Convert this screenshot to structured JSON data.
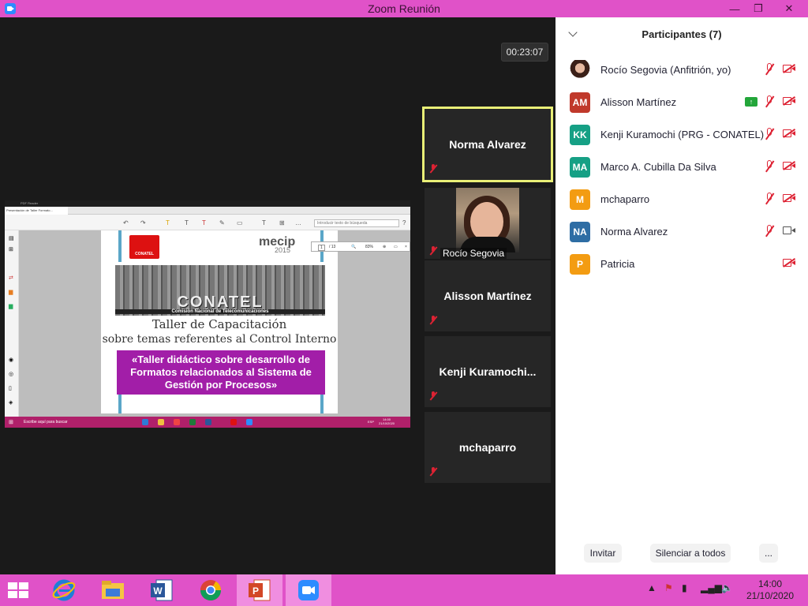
{
  "window": {
    "title": "Zoom Reunión",
    "min": "—",
    "max": "❐",
    "close": "✕"
  },
  "timer": "00:23:07",
  "shared_screen": {
    "app_title": "PDF Reader",
    "tab": "Presentación de Taller Formato...",
    "search_placeholder": "Introducir texto de búsqueda",
    "page": "1",
    "pages": "/ 13",
    "zoom": "83%",
    "slide": {
      "logo": "CONATEL",
      "mecip": "mecip",
      "mecip_year": "2015",
      "building_text": "CONATEL",
      "building_sub": "Comisión Nacional de Telecomunicaciones",
      "line1": "Taller de Capacitación",
      "line2": "sobre temas referentes al Control Interno",
      "box": "«Taller didáctico sobre desarrollo de Formatos relacionados al Sistema de Gestión por Procesos»"
    },
    "taskbar": {
      "search": "Escribe aquí para buscar",
      "time": "14:00",
      "date": "21/10/2020",
      "lang": "ESP"
    }
  },
  "tiles": [
    {
      "name": "Norma Alvarez"
    },
    {
      "name": "Rocío Segovia"
    },
    {
      "name": "Alisson Martínez"
    },
    {
      "name": "Kenji  Kuramochi..."
    },
    {
      "name": "mchaparro"
    }
  ],
  "participants": {
    "header": "Participantes (7)",
    "list": [
      {
        "initials": "",
        "name": "Rocío Segovia (Anfitrión, yo)",
        "color": "#ffffff",
        "photo": true,
        "mic": "muted",
        "cam": "off",
        "sharing": false
      },
      {
        "initials": "AM",
        "name": "Alisson Martínez",
        "color": "#c0392b",
        "mic": "muted",
        "cam": "off",
        "sharing": true
      },
      {
        "initials": "KK",
        "name": "Kenji Kuramochi (PRG - CONATEL)",
        "color": "#16a085",
        "mic": "muted",
        "cam": "off",
        "sharing": false
      },
      {
        "initials": "MA",
        "name": "Marco A. Cubilla Da Silva",
        "color": "#16a085",
        "mic": "muted",
        "cam": "off",
        "sharing": false
      },
      {
        "initials": "M",
        "name": "mchaparro",
        "color": "#f39c12",
        "mic": "muted",
        "cam": "off",
        "sharing": false
      },
      {
        "initials": "NA",
        "name": "Norma Alvarez",
        "color": "#2e6da4",
        "mic": "muted",
        "cam": "on",
        "sharing": false
      },
      {
        "initials": "P",
        "name": "Patricia",
        "color": "#f39c12",
        "mic": "none",
        "cam": "off",
        "sharing": false
      }
    ],
    "footer": {
      "invite": "Invitar",
      "mute_all": "Silenciar a todos",
      "more": "..."
    }
  },
  "taskbar": {
    "apps": [
      "start-button",
      "internet-explorer-icon",
      "file-explorer-icon",
      "word-icon",
      "chrome-icon",
      "powerpoint-icon",
      "zoom-icon"
    ],
    "time": "14:00",
    "date": "21/10/2020"
  }
}
